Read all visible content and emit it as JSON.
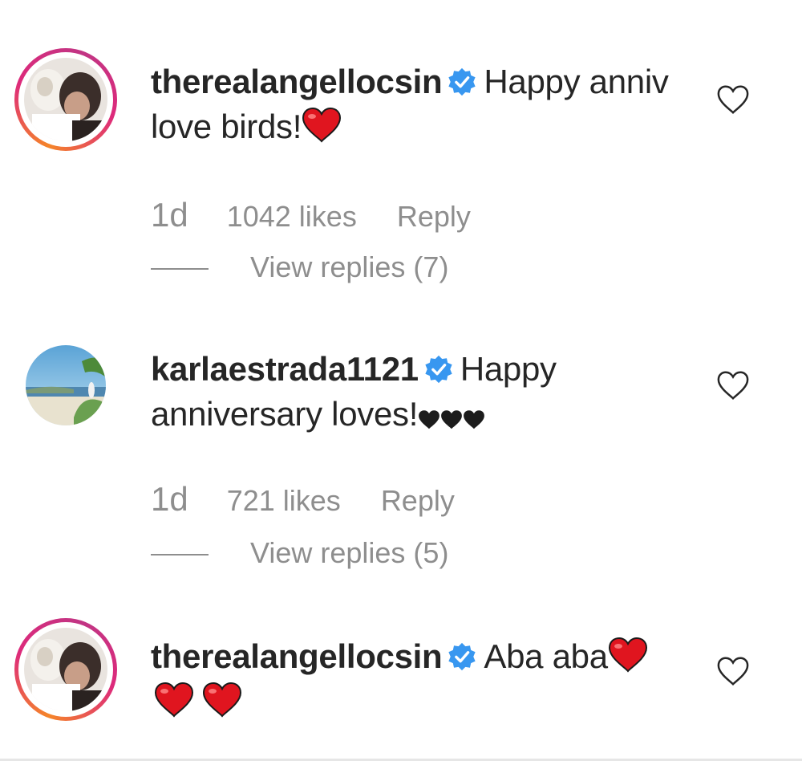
{
  "comments": [
    {
      "username": "therealangellocsin",
      "verified": true,
      "text": "Happy anniv love birds!",
      "emoji": [
        "red-heart"
      ],
      "time": "1d",
      "likes": "1042 likes",
      "reply_label": "Reply",
      "view_replies": "View replies (7)"
    },
    {
      "username": "karlaestrada1121",
      "verified": true,
      "text": "Happy anniversary loves!",
      "emoji": [
        "black-heart",
        "black-heart",
        "black-heart"
      ],
      "time": "1d",
      "likes": "721 likes",
      "reply_label": "Reply",
      "view_replies": "View replies (5)"
    },
    {
      "username": "therealangellocsin",
      "verified": true,
      "text": "Aba aba",
      "emoji": [
        "red-heart",
        "red-heart",
        "red-heart"
      ]
    }
  ],
  "colors": {
    "verified": "#3897f0",
    "heart_red": "#e0151f",
    "muted": "#8e8e8e",
    "text": "#262626"
  },
  "icons": {
    "like": "heart-outline-icon",
    "verified": "verified-badge-icon"
  }
}
